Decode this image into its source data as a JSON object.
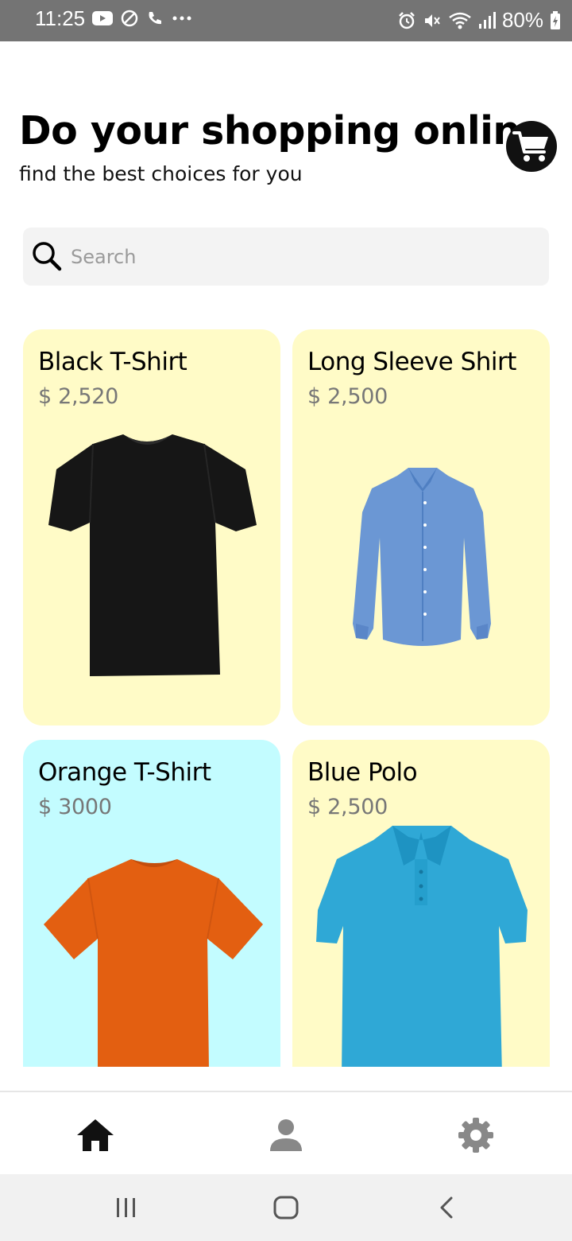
{
  "status_bar": {
    "time": "11:25",
    "battery": "80%"
  },
  "header": {
    "title": "Do your shopping online",
    "subtitle": "find the best choices for you"
  },
  "search": {
    "placeholder": "Search",
    "value": ""
  },
  "products": [
    {
      "name": "Black T-Shirt",
      "price": "$ 2,520",
      "card_color": "#fffbc7",
      "icon": "black-tshirt-image"
    },
    {
      "name": "Long Sleeve Shirt",
      "price": "$ 2,500",
      "card_color": "#fffbc7",
      "icon": "blue-long-sleeve-shirt-image"
    },
    {
      "name": "Orange T-Shirt",
      "price": "$ 3000",
      "card_color": "#c3fcff",
      "icon": "orange-tshirt-image"
    },
    {
      "name": "Blue Polo",
      "price": "$ 2,500",
      "card_color": "#fffbc7",
      "icon": "blue-polo-image"
    }
  ],
  "bottom_nav": {
    "items": [
      {
        "icon": "home-icon",
        "active": true
      },
      {
        "icon": "person-icon",
        "active": false
      },
      {
        "icon": "gear-icon",
        "active": false
      }
    ]
  },
  "colors": {
    "accent": "#000000",
    "yellow_card": "#fffbc7",
    "cyan_card": "#c3fcff",
    "status_bar": "#747474"
  }
}
